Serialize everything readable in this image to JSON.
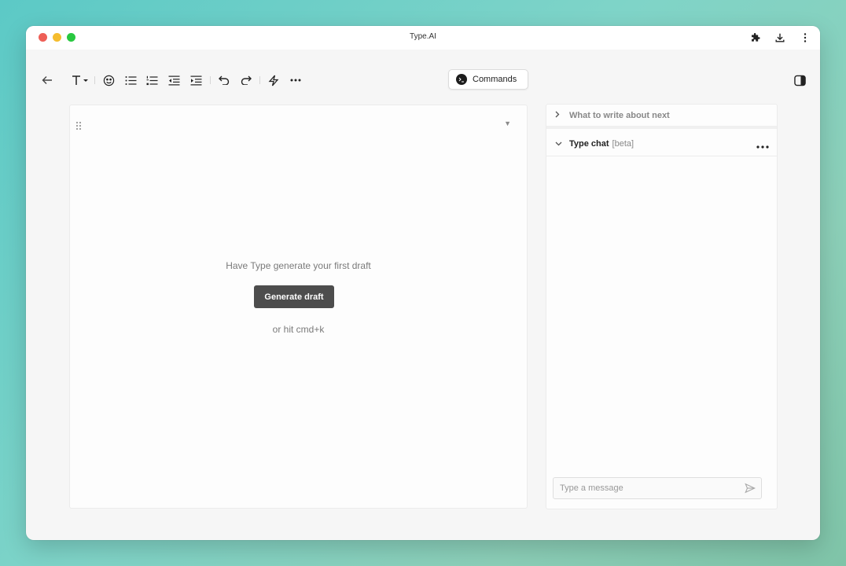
{
  "window": {
    "title": "Type.AI"
  },
  "colors": {
    "accent_button": "#4d4d4d",
    "background_teal": "#5cc9c6"
  },
  "titlebar_icons": [
    "puzzle-icon",
    "download-icon",
    "kebab-menu-icon"
  ],
  "toolbar": {
    "items": [
      "back-arrow-icon",
      "text-style-icon",
      "emoji-icon",
      "bullet-list-icon",
      "numbered-list-icon",
      "outdent-icon",
      "indent-icon",
      "undo-icon",
      "redo-icon",
      "ai-sparkle-icon",
      "more-options-icon"
    ],
    "commands_label": "Commands",
    "right_icon": "sidebar-toggle-icon"
  },
  "editor": {
    "prompt": "Have Type generate your first draft",
    "generate_button": "Generate draft",
    "hint": "or hit cmd+k"
  },
  "sidepanel": {
    "section1": "What to write about next",
    "chat_title": "Type chat",
    "chat_badge": "[beta]",
    "message_placeholder": "Type a message"
  }
}
